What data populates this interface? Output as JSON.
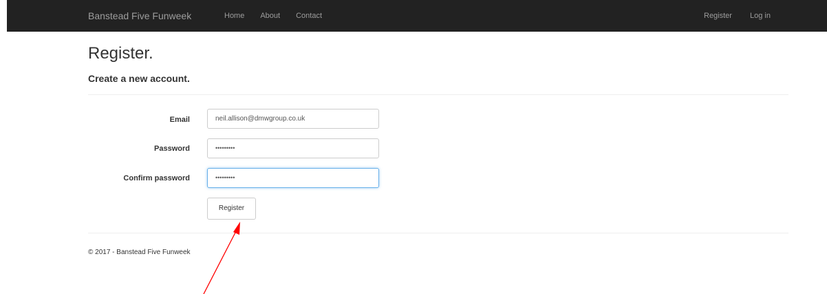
{
  "navbar": {
    "brand": "Banstead Five Funweek",
    "left_links": [
      "Home",
      "About",
      "Contact"
    ],
    "right_links": [
      "Register",
      "Log in"
    ],
    "background_color": "#222222",
    "link_color": "#9d9d9d"
  },
  "page": {
    "title": "Register.",
    "subtitle": "Create a new account."
  },
  "form": {
    "email": {
      "label": "Email",
      "value": "neil.allison@dmwgroup.co.uk"
    },
    "password": {
      "label": "Password",
      "value": "•••••••••"
    },
    "confirm_password": {
      "label": "Confirm password",
      "value": "•••••••••",
      "focused": true
    },
    "submit_label": "Register",
    "focus_color": "#66afe9"
  },
  "footer": {
    "text": "© 2017 - Banstead Five Funweek"
  },
  "annotation": {
    "icon": "arrow-icon",
    "color": "#ff0000"
  }
}
